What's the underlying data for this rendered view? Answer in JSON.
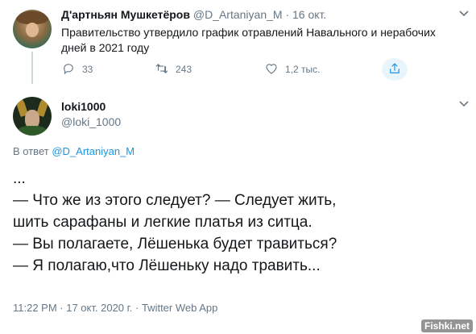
{
  "tweet1": {
    "display_name": "Д'артньян Мушкетёров",
    "handle": "@D_Artaniyan_M",
    "separator": "·",
    "date": "16 окт.",
    "text": "Правительство утвердило график отравлений Навального и нерабочих дней в 2021 году",
    "replies": "33",
    "retweets": "243",
    "likes": "1,2 тыс."
  },
  "tweet2": {
    "display_name": "loki1000",
    "handle": "@loki_1000",
    "reply_prefix": "В ответ",
    "reply_to": "@D_Artaniyan_M",
    "lines": [
      "...",
      "— Что же из этого следует? — Следует жить,",
      "шить сарафаны и легкие платья из ситца.",
      "— Вы полагаете, Лёшенька будет травиться?",
      "— Я полагаю,что Лёшеньку надо травить..."
    ],
    "meta": "11:22 PM · 17 окт. 2020 г. · Twitter Web App"
  },
  "watermark": "Fishki.net",
  "colors": {
    "text": "#14171a",
    "secondary": "#657786",
    "link": "#1b95e0",
    "thread_line": "#ccd6dd"
  },
  "icons": [
    "reply-icon",
    "retweet-icon",
    "like-icon",
    "share-icon",
    "chevron-down-icon"
  ]
}
